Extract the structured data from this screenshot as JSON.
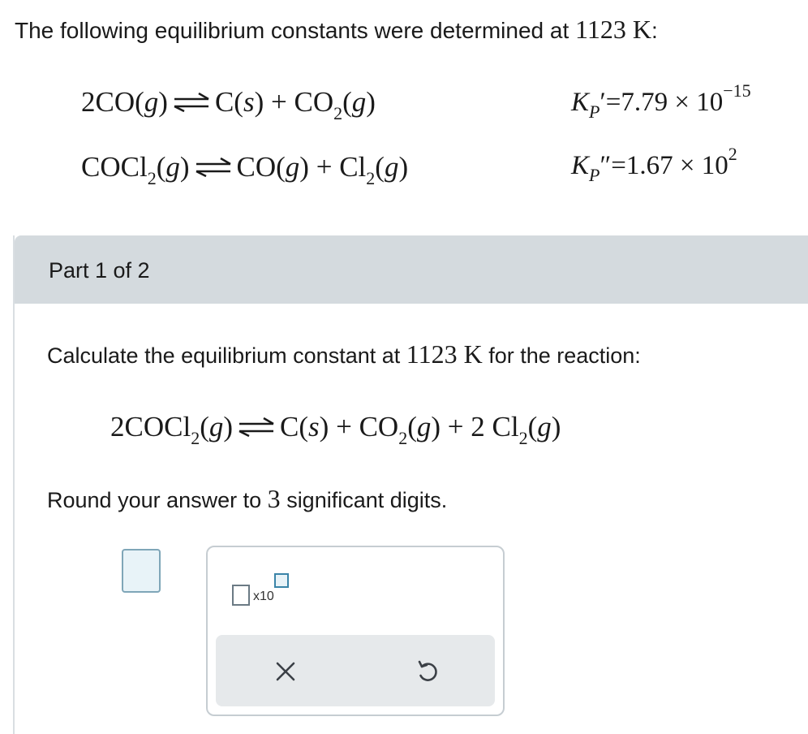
{
  "intro": {
    "text": "The following equilibrium constants were determined at",
    "temperature": "1123 K",
    "colon": ":"
  },
  "reactions": [
    {
      "lhs_coef": "2",
      "lhs": "CO",
      "lhs_state": "g",
      "p1": "C",
      "p1_state": "s",
      "plus": "+",
      "p2": "CO",
      "p2_sub": "2",
      "p2_state": "g"
    },
    {
      "lhs": "COCl",
      "lhs_sub": "2",
      "lhs_state": "g",
      "p1": "CO",
      "p1_state": "g",
      "plus": "+",
      "p2": "Cl",
      "p2_sub": "2",
      "p2_state": "g"
    }
  ],
  "constants": [
    {
      "symbol": "K",
      "subscript": "P",
      "prime": "′",
      "eq": "=",
      "mantissa": "7.79",
      "times": "×",
      "base": "10",
      "exponent": "−15"
    },
    {
      "symbol": "K",
      "subscript": "P",
      "prime": "″",
      "eq": "=",
      "mantissa": "1.67",
      "times": "×",
      "base": "10",
      "exponent": "2"
    }
  ],
  "part": {
    "label": "Part 1 of 2"
  },
  "question": {
    "text": "Calculate the equilibrium constant at",
    "temperature": "1123 K",
    "suffix": "for the reaction:"
  },
  "target_reaction": {
    "coef": "2",
    "lhs": "COCl",
    "lhs_sub": "2",
    "lhs_state": "g",
    "p1": "C",
    "p1_state": "s",
    "plus": "+",
    "p2": "CO",
    "p2_sub": "2",
    "p2_state": "g",
    "p3_coef": "2",
    "p3": "Cl",
    "p3_sub": "2",
    "p3_state": "g"
  },
  "round": {
    "prefix": "Round your answer to",
    "digits": "3",
    "suffix": "significant digits."
  },
  "tools": {
    "x10_label": "x10",
    "clear_icon": "close-icon",
    "reset_icon": "undo-icon"
  },
  "colors": {
    "header_bg": "#d4dade",
    "accent": "#3a84a8",
    "input_bg": "#e8f3f8"
  }
}
